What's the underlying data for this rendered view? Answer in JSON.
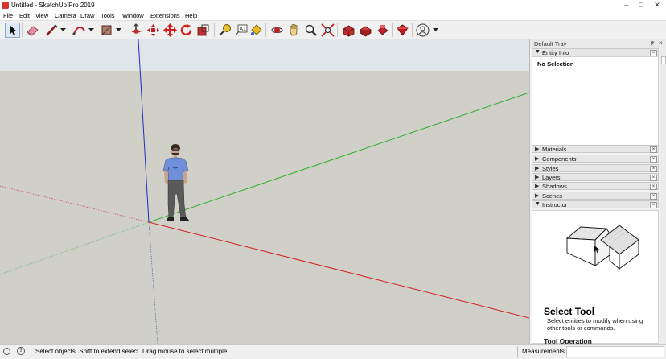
{
  "window": {
    "title": "Untitled - SketchUp Pro 2019",
    "minimize_glyph": "–",
    "maximize_glyph": "□",
    "close_glyph": "✕"
  },
  "menu": [
    "File",
    "Edit",
    "View",
    "Camera",
    "Draw",
    "Tools",
    "Window",
    "Extensions",
    "Help"
  ],
  "toolbar": {
    "icons": [
      "select-icon",
      "eraser-icon",
      "line-icon",
      "arc-icon",
      "rectangle-icon",
      "push-pull-icon",
      "move-icon",
      "rotate-icon",
      "scale-icon",
      "tape-measure-icon",
      "text-icon",
      "paint-bucket-icon",
      "orbit-icon",
      "pan-icon",
      "zoom-icon",
      "zoom-extents-icon",
      "warehouse-icon",
      "extension-warehouse-icon",
      "layout-icon",
      "sketchup-ruby-icon",
      "account-icon"
    ]
  },
  "tray": {
    "title": "Default Tray",
    "pin_glyph": "ᵽ",
    "close_glyph": "×",
    "entity_info": {
      "label": "Entity Info",
      "selection": "No Selection"
    },
    "panels": [
      "Materials",
      "Components",
      "Styles",
      "Layers",
      "Shadows",
      "Scenes",
      "Instructor"
    ],
    "instructor": {
      "tool_title": "Select Tool",
      "tool_description": "Select entities to modify when using other tools or commands.",
      "tool_operation": "Tool Operation"
    }
  },
  "status": {
    "message": "Select objects. Shift to extend select. Drag mouse to select multiple.",
    "measurements_label": "Measurements",
    "info_glyph": "!"
  },
  "colors": {
    "axis_red": "#d02020",
    "axis_green": "#30b030",
    "axis_blue": "#2030c0",
    "sky": "#dfe6ea",
    "ground": "#d0d0c8"
  }
}
